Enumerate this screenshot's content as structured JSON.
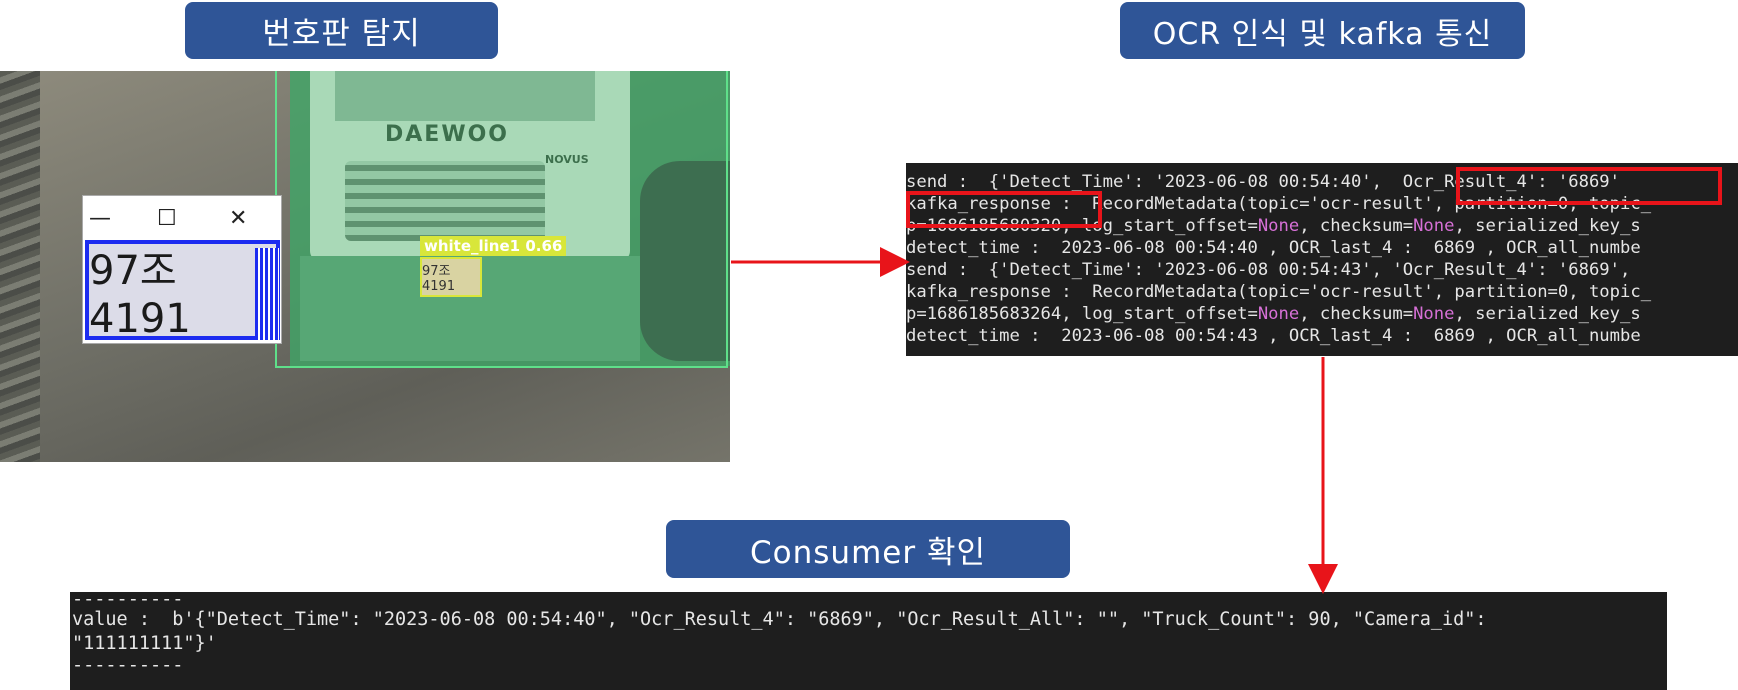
{
  "headers": {
    "plate_detection": "번호판 탐지",
    "ocr_kafka": "OCR 인식 및 kafka 통신",
    "consumer": "Consumer 확인"
  },
  "scene": {
    "truck_brand": "DAEWOO",
    "truck_badge": "NOVUS",
    "detection_label": "white_line1 0.66",
    "detection_plate_text": "97조4191",
    "popup_plate_text": "97조4191",
    "popup_controls": {
      "minimize": "—",
      "maximize": "☐",
      "close": "✕"
    }
  },
  "ocr_terminal": {
    "lines": [
      {
        "text": "send :  {'Detect_Time': '2023-06-08 00:54:40',  Ocr_Result_4': '6869'"
      },
      {
        "text": "kafka_response :  RecordMetadata(topic='ocr-result', partition=0, topic_"
      },
      {
        "pre": "p=1686185680320, log_start_offset=",
        "none1": "None",
        "mid": ", checksum=",
        "none2": "None",
        "post": ", serialized_key_s"
      },
      {
        "text": "detect_time :  2023-06-08 00:54:40 , OCR_last_4 :  6869 , OCR_all_numbe"
      },
      {
        "text": "send :  {'Detect_Time': '2023-06-08 00:54:43', 'Ocr_Result_4': '6869',"
      },
      {
        "text": "kafka_response :  RecordMetadata(topic='ocr-result', partition=0, topic_"
      },
      {
        "pre": "p=1686185683264, log_start_offset=",
        "none1": "None",
        "mid": ", checksum=",
        "none2": "None",
        "post": ", serialized_key_s"
      },
      {
        "text": "detect_time :  2023-06-08 00:54:43 , OCR_last_4 :  6869 , OCR_all_numbe"
      }
    ]
  },
  "consumer_terminal": {
    "lines": [
      "----------",
      "value :  b'{\"Detect_Time\": \"2023-06-08 00:54:40\", \"Ocr_Result_4\": \"6869\", \"Ocr_Result_All\": \"\", \"Truck_Count\": 90, \"Camera_id\":",
      "\"111111111\"}'",
      "----------"
    ]
  },
  "colors": {
    "header_bg": "#2f5597",
    "arrow": "#e8141a",
    "highlight": "#e8141a",
    "terminal_bg": "#1e1e1e",
    "none_keyword": "#d670d6",
    "plate_box": "#1c2cf0",
    "detection_box": "#d8e63a"
  }
}
